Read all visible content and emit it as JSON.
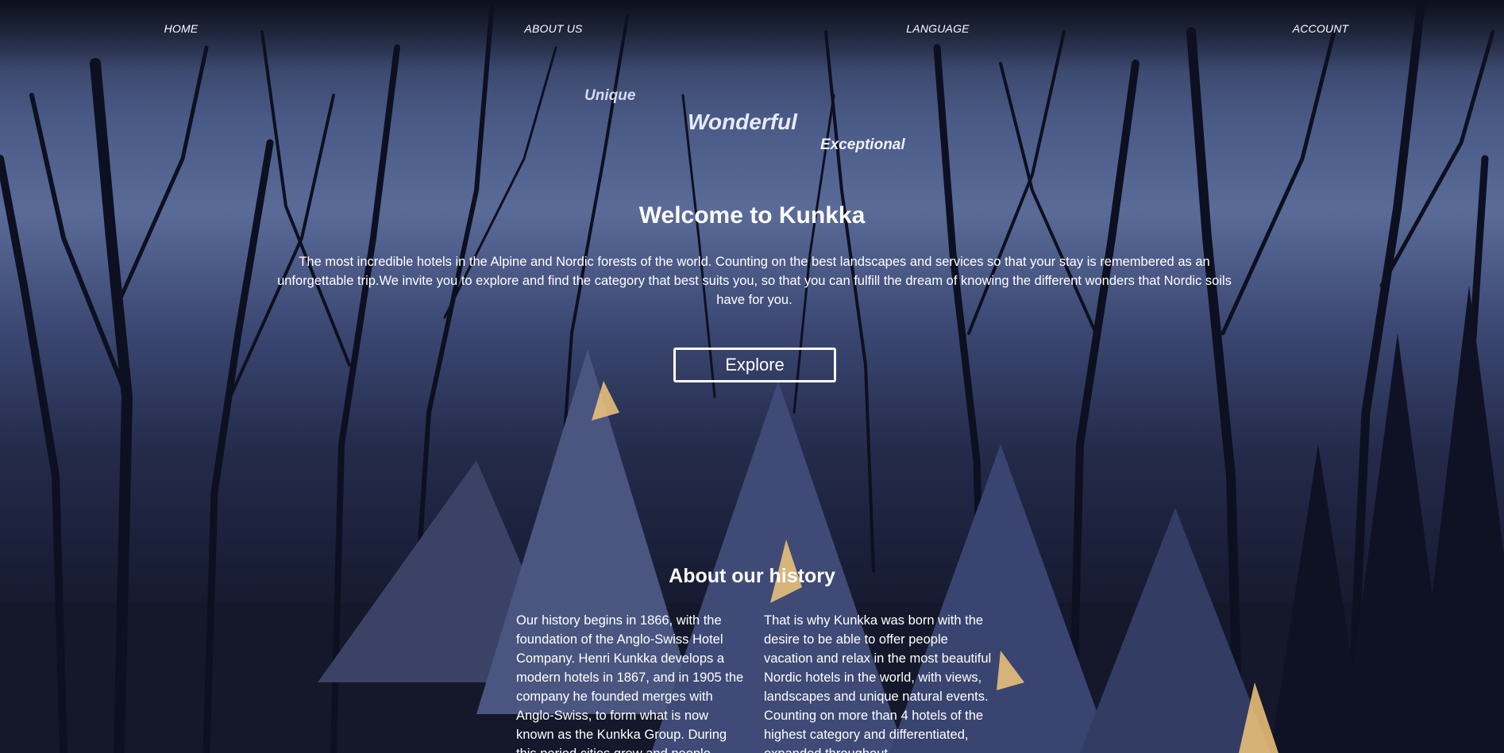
{
  "nav": {
    "items": [
      {
        "label": "HOME"
      },
      {
        "label": "ABOUT US"
      },
      {
        "label": "LANGUAGE"
      },
      {
        "label": "ACCOUNT"
      }
    ]
  },
  "hero": {
    "taglines": {
      "unique": "Unique",
      "wonderful": "Wonderful",
      "exceptional": "Exceptional"
    },
    "title": "Welcome to Kunkka",
    "intro": "The most incredible hotels in the Alpine and Nordic forests of the world. Counting on the best landscapes and services so that your stay is remembered as an unforgettable trip.We invite you to explore and find the category that best suits you, so that you can fulfill the dream of knowing the different wonders that Nordic soils have for you.",
    "explore_label": "Explore"
  },
  "history": {
    "title": "About our history",
    "left_text": "Our history begins in 1866, with the foundation of the Anglo-Swiss Hotel Company. Henri Kunkka develops a modern hotels in 1867, and in 1905 the company he founded merges with Anglo-Swiss, to form what is now known as the Kunkka Group. During this period cities grew and people",
    "right_text": "That is why Kunkka was born with the desire to be able to offer people vacation and relax in the most beautiful Nordic hotels in the world, with views, landscapes and unique natural events. Counting on more than 4 hotels of the highest category and differentiated, expanded throughout"
  },
  "colors": {
    "text": "#ffffff",
    "sky": "#4a5a86",
    "night": "#0f1224",
    "window_glow": "#f2c77a"
  }
}
